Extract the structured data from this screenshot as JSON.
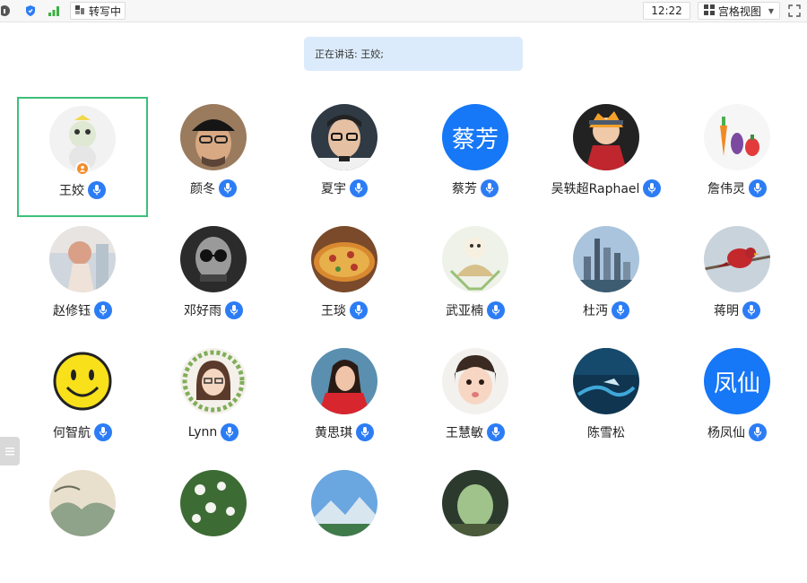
{
  "topbar": {
    "status_label": "转写中",
    "clock": "12:22",
    "view_label": "宫格视图"
  },
  "speaking": {
    "text": "正在讲话: 王姣;"
  },
  "participants": [
    {
      "name": "王姣",
      "avatar": "photo-pepe",
      "host": true,
      "active": true
    },
    {
      "name": "颜冬",
      "avatar": "photo-man-cap"
    },
    {
      "name": "夏宇",
      "avatar": "photo-man-glasses"
    },
    {
      "name": "蔡芳",
      "avatar": "text",
      "avatar_text": "蔡芳"
    },
    {
      "name": "吴轶超Raphael",
      "avatar": "photo-anime"
    },
    {
      "name": "詹伟灵",
      "avatar": "photo-vegetables"
    },
    {
      "name": "赵修钰",
      "avatar": "photo-girl-back"
    },
    {
      "name": "邓好雨",
      "avatar": "photo-bw-glasses"
    },
    {
      "name": "王琰",
      "avatar": "photo-pizza"
    },
    {
      "name": "武亚楠",
      "avatar": "photo-dog-fan"
    },
    {
      "name": "杜沔",
      "avatar": "photo-city"
    },
    {
      "name": "蒋明",
      "avatar": "photo-bird"
    },
    {
      "name": "何智航",
      "avatar": "photo-smiley"
    },
    {
      "name": "Lynn",
      "avatar": "photo-cartoon-girl"
    },
    {
      "name": "黄思琪",
      "avatar": "photo-girl-red"
    },
    {
      "name": "王慧敏",
      "avatar": "photo-baby"
    },
    {
      "name": "陈雪松",
      "avatar": "photo-ocean",
      "mic": false
    },
    {
      "name": "杨凤仙",
      "avatar": "text",
      "avatar_text": "凤仙"
    },
    {
      "name": "",
      "avatar": "photo-painting"
    },
    {
      "name": "",
      "avatar": "photo-flowers"
    },
    {
      "name": "",
      "avatar": "photo-mountain"
    },
    {
      "name": "",
      "avatar": "photo-cave"
    }
  ],
  "colors": {
    "accent": "#1677f7",
    "mic": "#2c7cf5",
    "active_border": "#3cc07a",
    "speaking_bg": "#dcebfb",
    "host_badge": "#f28c2a"
  }
}
